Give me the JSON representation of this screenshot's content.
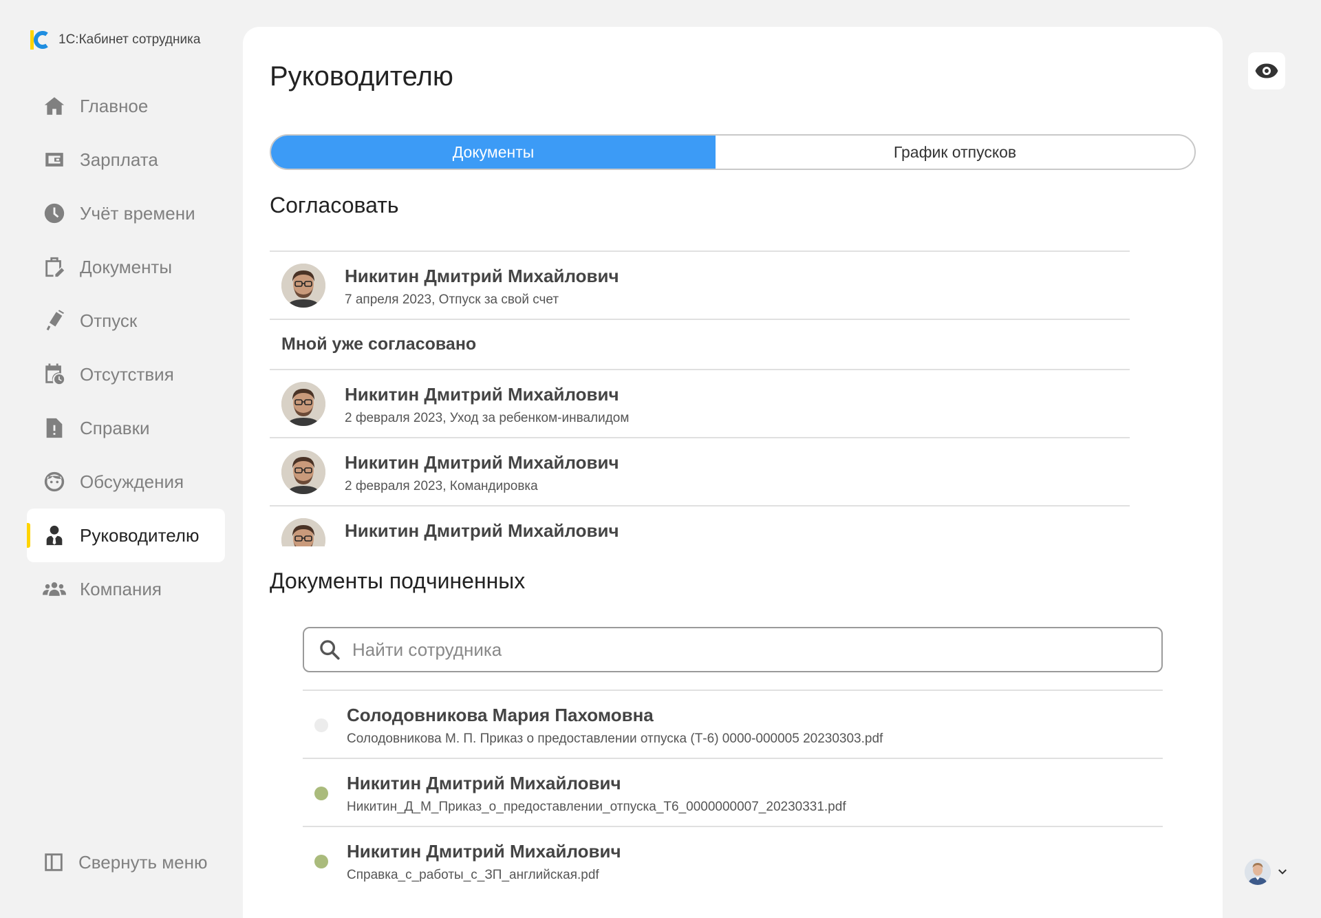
{
  "app": {
    "title": "1С:Кабинет сотрудника",
    "brand_colors": {
      "yellow": "#ffd400",
      "blue": "#1f8ee0"
    }
  },
  "sidebar": {
    "items": [
      {
        "label": "Главное",
        "icon": "home-icon",
        "active": false
      },
      {
        "label": "Зарплата",
        "icon": "wallet-icon",
        "active": false
      },
      {
        "label": "Учёт времени",
        "icon": "clock-icon",
        "active": false
      },
      {
        "label": "Документы",
        "icon": "clipboard-edit-icon",
        "active": false
      },
      {
        "label": "Отпуск",
        "icon": "suitcase-icon",
        "active": false
      },
      {
        "label": "Отсутствия",
        "icon": "calendar-clock-icon",
        "active": false
      },
      {
        "label": "Справки",
        "icon": "document-alert-icon",
        "active": false
      },
      {
        "label": "Обсуждения",
        "icon": "chat-face-icon",
        "active": false
      },
      {
        "label": "Руководителю",
        "icon": "manager-icon",
        "active": true
      },
      {
        "label": "Компания",
        "icon": "group-icon",
        "active": false
      }
    ],
    "collapse_label": "Свернуть меню"
  },
  "main": {
    "page_title": "Руководителю",
    "tabs": [
      {
        "label": "Документы",
        "active": true
      },
      {
        "label": "График отпусков",
        "active": false
      }
    ],
    "approve": {
      "title": "Согласовать",
      "pending": [
        {
          "name": "Никитин Дмитрий Михайлович",
          "sub": "7 апреля 2023, Отпуск за свой счет"
        }
      ],
      "approved_title": "Мной уже согласовано",
      "approved": [
        {
          "name": "Никитин Дмитрий Михайлович",
          "sub": "2 февраля 2023, Уход за ребенком-инвалидом"
        },
        {
          "name": "Никитин Дмитрий Михайлович",
          "sub": "2 февраля 2023, Командировка"
        },
        {
          "name": "Никитин Дмитрий Михайлович",
          "sub": ""
        }
      ]
    },
    "subordinates": {
      "title": "Документы подчиненных",
      "search_placeholder": "Найти сотрудника",
      "search_value": "",
      "docs": [
        {
          "name": "Солодовникова Мария Пахомовна",
          "file": "Солодовникова М. П. Приказ о предоставлении отпуска (Т-6) 0000-000005 20230303.pdf",
          "status_color": "#ececec"
        },
        {
          "name": "Никитин Дмитрий Михайлович",
          "file": "Никитин_Д_М_Приказ_о_предоставлении_отпуска_Т6_0000000007_20230331.pdf",
          "status_color": "#aabb7c"
        },
        {
          "name": "Никитин Дмитрий Михайлович",
          "file": "Справка_с_работы_с_ЗП_английская.pdf",
          "status_color": "#aabb7c"
        }
      ]
    }
  },
  "colors": {
    "accent": "#3c9bf6",
    "active_marker": "#ffd400"
  }
}
